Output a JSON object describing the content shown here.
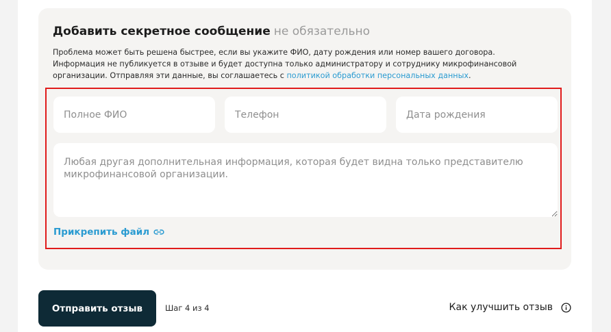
{
  "secret_section": {
    "title": "Добавить секретное сообщение",
    "optional_label": "не обязательно",
    "description_text": "Проблема может быть решена быстрее, если вы укажите ФИО, дату рождения или номер вашего договора. Информация не публикуется в отзыве и будет доступна только администратору и сотруднику микрофинансовой организации. Отправляя эти данные, вы соглашаетесь с ",
    "privacy_link": "политикой обработки персональных данных",
    "description_end": ".",
    "fields": {
      "full_name_placeholder": "Полное ФИО",
      "phone_placeholder": "Телефон",
      "dob_placeholder": "Дата рождения",
      "extra_info_placeholder": "Любая другая дополнительная информация, которая будет видна только представителю микрофинансовой организации."
    },
    "attach_label": "Прикрепить файл",
    "attach_icon": "link-icon"
  },
  "footer": {
    "submit_label": "Отправить отзыв",
    "step_text": "Шаг 4 из 4",
    "improve_label": "Как улучшить отзыв",
    "improve_icon": "info-icon"
  },
  "colors": {
    "accent_link": "#2a9bd1",
    "submit_bg": "#0e2a36",
    "highlight_border": "#e01b1b",
    "card_bg": "#f5f4f2"
  }
}
